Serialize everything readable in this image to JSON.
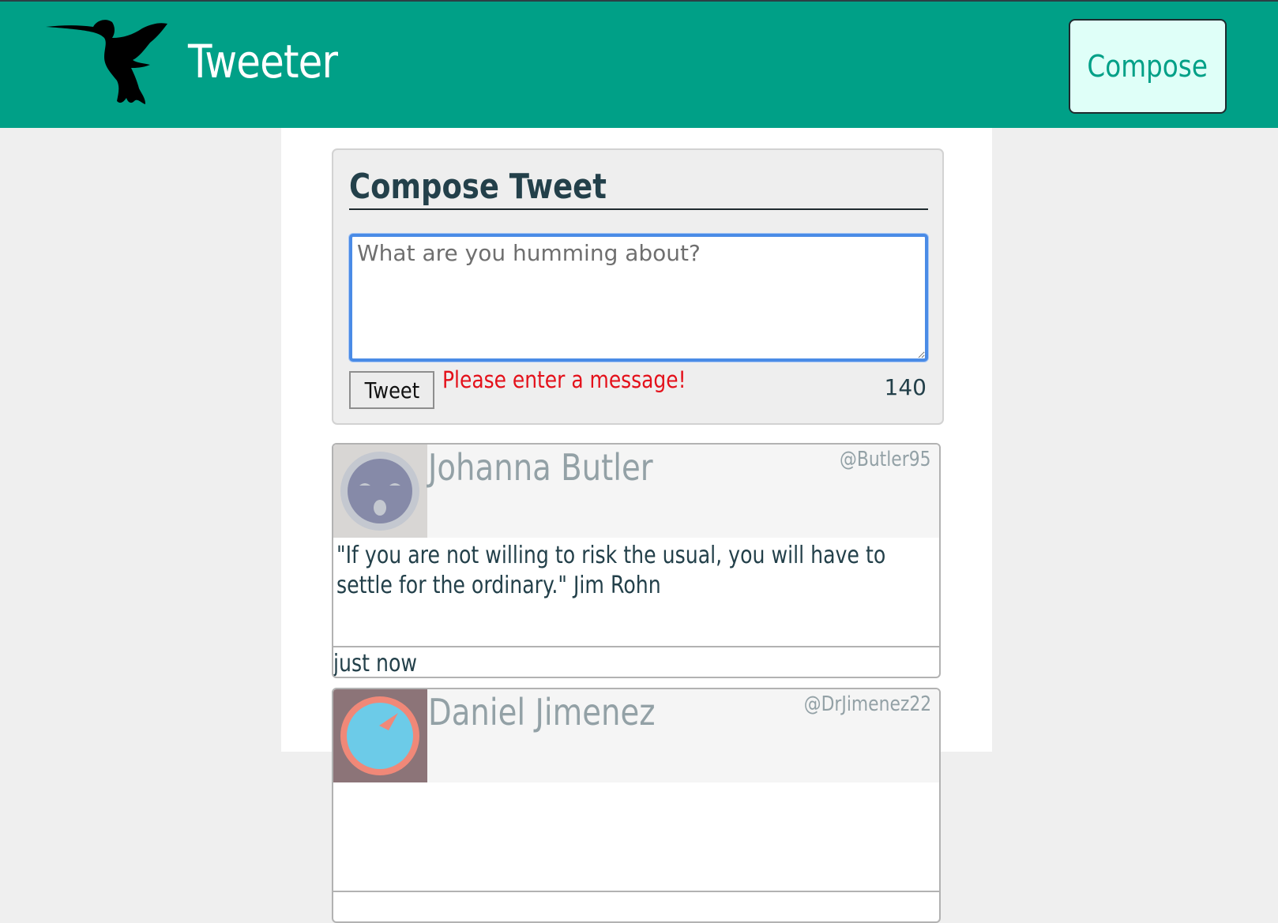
{
  "header": {
    "brand_title": "Tweeter",
    "logo_icon": "hummingbird-icon",
    "compose_label": "Compose",
    "colors": {
      "bar": "#00a087",
      "compose_bg": "#dffff8"
    }
  },
  "compose": {
    "heading": "Compose Tweet",
    "textarea_value": "",
    "placeholder": "What are you humming about?",
    "tweet_label": "Tweet",
    "error_message": "Please enter a message!",
    "char_count": "140"
  },
  "tweets": [
    {
      "name": "Johanna Butler",
      "handle": "@Butler95",
      "content": "\"If you are not willing to risk the usual, you will have to settle for the ordinary.\" Jim Rohn",
      "timestamp": "just now",
      "avatar_icon": "surprised-face-avatar"
    },
    {
      "name": "Daniel Jimenez",
      "handle": "@DrJimenez22",
      "content": "",
      "timestamp": "",
      "avatar_icon": "bird-avatar"
    }
  ]
}
